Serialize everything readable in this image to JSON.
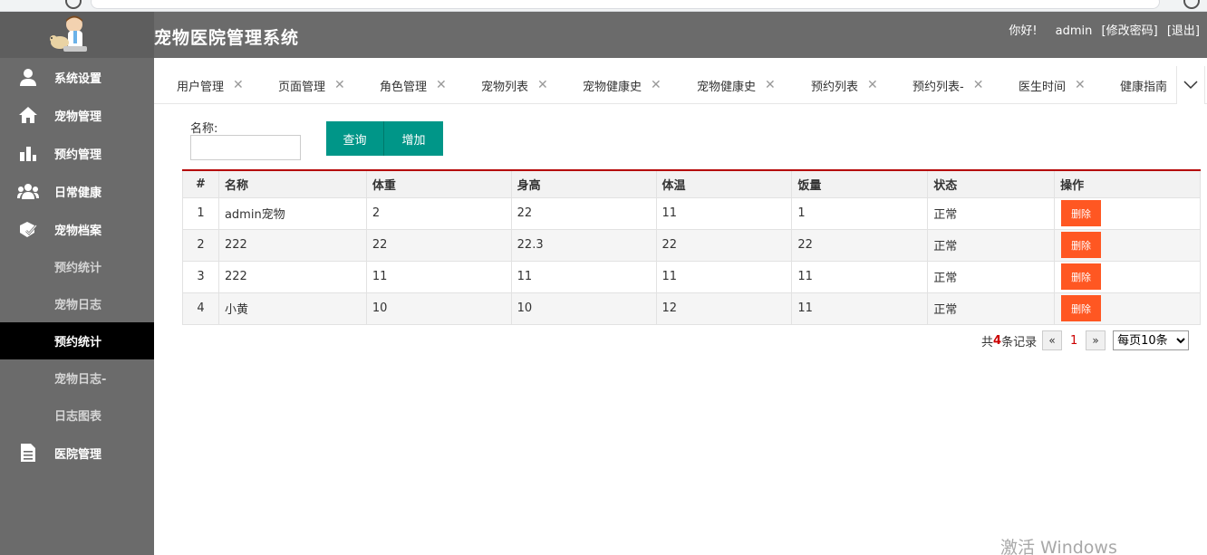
{
  "header": {
    "title": "宠物医院管理系统",
    "greeting": "你好!",
    "username": "admin",
    "change_password": "[修改密码]",
    "logout": "[退出]"
  },
  "sidebar": {
    "items": [
      {
        "label": "系统设置",
        "icon": "user-icon"
      },
      {
        "label": "宠物管理",
        "icon": "home-icon"
      },
      {
        "label": "预约管理",
        "icon": "bar-chart-icon"
      },
      {
        "label": "日常健康",
        "icon": "users-icon"
      },
      {
        "label": "宠物档案",
        "icon": "paw-icon"
      }
    ],
    "sub_items": [
      {
        "label": "预约统计",
        "active": false
      },
      {
        "label": "宠物日志",
        "active": false
      },
      {
        "label": "预约统计",
        "active": true
      },
      {
        "label": "宠物日志-",
        "active": false
      },
      {
        "label": "日志图表",
        "active": false
      }
    ],
    "last_item": {
      "label": "医院管理",
      "icon": "document-icon"
    }
  },
  "tabs": [
    "用户管理",
    "页面管理",
    "角色管理",
    "宠物列表",
    "宠物健康史",
    "宠物健康史",
    "预约列表",
    "预约列表-",
    "医生时间",
    "健康指南"
  ],
  "search": {
    "label": "名称:",
    "value": "",
    "query_label": "查询",
    "add_label": "增加"
  },
  "table": {
    "columns": [
      "#",
      "名称",
      "体重",
      "身高",
      "体温",
      "饭量",
      "状态",
      "操作"
    ],
    "rows": [
      {
        "index": "1",
        "name": "admin宠物",
        "weight": "2",
        "height": "22",
        "temp": "11",
        "food": "1",
        "status": "正常"
      },
      {
        "index": "2",
        "name": "222",
        "weight": "22",
        "height": "22.3",
        "temp": "22",
        "food": "22",
        "status": "正常"
      },
      {
        "index": "3",
        "name": "222",
        "weight": "11",
        "height": "11",
        "temp": "11",
        "food": "11",
        "status": "正常"
      },
      {
        "index": "4",
        "name": "小黄",
        "weight": "10",
        "height": "10",
        "temp": "12",
        "food": "11",
        "status": "正常"
      }
    ],
    "delete_label": "删除"
  },
  "pagination": {
    "total_prefix": "共",
    "total": "4",
    "total_suffix": "条记录",
    "prev": "«",
    "current": "1",
    "next": "»",
    "page_size": "每页10条"
  },
  "watermark": "激活 Windows",
  "colors": {
    "primary": "#009688",
    "danger": "#ff5722",
    "header": "#6b6b6b",
    "active_nav": "#000000",
    "table_accent": "#b50000"
  }
}
